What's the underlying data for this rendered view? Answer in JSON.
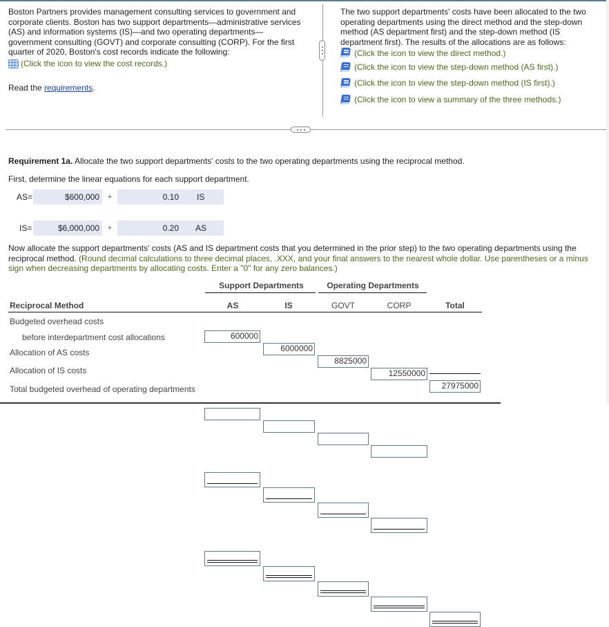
{
  "problem": {
    "intro_text": "Boston Partners provides management consulting services to government and corporate clients. Boston has two support departments—administrative services (AS) and information systems (IS)—and two operating departments—government consulting (GOVT) and corporate consulting (CORP). For the first quarter of 2020, Boston's cost records indicate the following:",
    "cost_records_link": "(Click the icon to view the cost records.)",
    "read_the": "Read the ",
    "requirements_link": "requirements",
    "period": "."
  },
  "right_panel": {
    "text": "The two support departments' costs have been allocated to the two operating departments using the direct method and the step-down method (AS department first) and the step-down method (IS department first). The results of the allocations are as follows:",
    "links": [
      {
        "icon": "book-icon",
        "label": "(Click the icon to view the direct method.)"
      },
      {
        "icon": "book-icon",
        "label": "(Click the icon to view the step-down method (AS first).)"
      },
      {
        "icon": "book-icon",
        "label": "(Click the icon to view the step-down method (IS first).)"
      },
      {
        "icon": "book-icon",
        "label": "(Click the icon to view a summary of the three methods.)"
      }
    ]
  },
  "requirement": {
    "label": "Requirement 1a.",
    "text": " Allocate the two support departments' costs to the two operating departments using the reciprocal method.",
    "first_line": "First, determine the linear equations for each support department."
  },
  "equations": [
    {
      "label": "AS=",
      "constant": "$600,000",
      "plus": "+",
      "coefficient": "0.10",
      "variable": "IS"
    },
    {
      "label": "IS=",
      "constant": "$6,000,000",
      "plus": "+",
      "coefficient": "0.20",
      "variable": "AS"
    }
  ],
  "instructions": {
    "main": "Now allocate the support departments' costs (AS and IS department costs that you determined in the prior step) to the two operating departments using the reciprocal method.",
    "note": " (Round decimal calculations to three decimal places, .XXX, and your final answers to the nearest whole dollar. Use parentheses or a minus sign when decreasing departments by allocating costs. Enter a \"0\" for any zero balances.)"
  },
  "table": {
    "group_support": "Support Departments",
    "group_operating": "Operating Departments",
    "title": "Reciprocal Method",
    "columns": [
      "AS",
      "IS",
      "GOVT",
      "CORP",
      "Total"
    ],
    "rows": [
      {
        "label": "Budgeted overhead costs",
        "values": null
      },
      {
        "label": "before interdepartment cost allocations",
        "values": [
          "600000",
          "6000000",
          "8825000",
          "12550000",
          "27975000"
        ]
      },
      {
        "label": "Allocation of AS costs",
        "values": [
          "",
          "",
          "",
          ""
        ]
      },
      {
        "label": "Allocation of IS costs",
        "values": [
          "",
          "",
          "",
          "",
          ""
        ]
      },
      {
        "label": "Total budgeted overhead of operating departments",
        "values": [
          "",
          "",
          "",
          "",
          ""
        ]
      }
    ]
  },
  "colors": {
    "hint_green": "#4a6a1c",
    "link_blue": "#1a3ea8",
    "input_border": "#5c7b86",
    "equation_bg": "#e3e8f2"
  }
}
